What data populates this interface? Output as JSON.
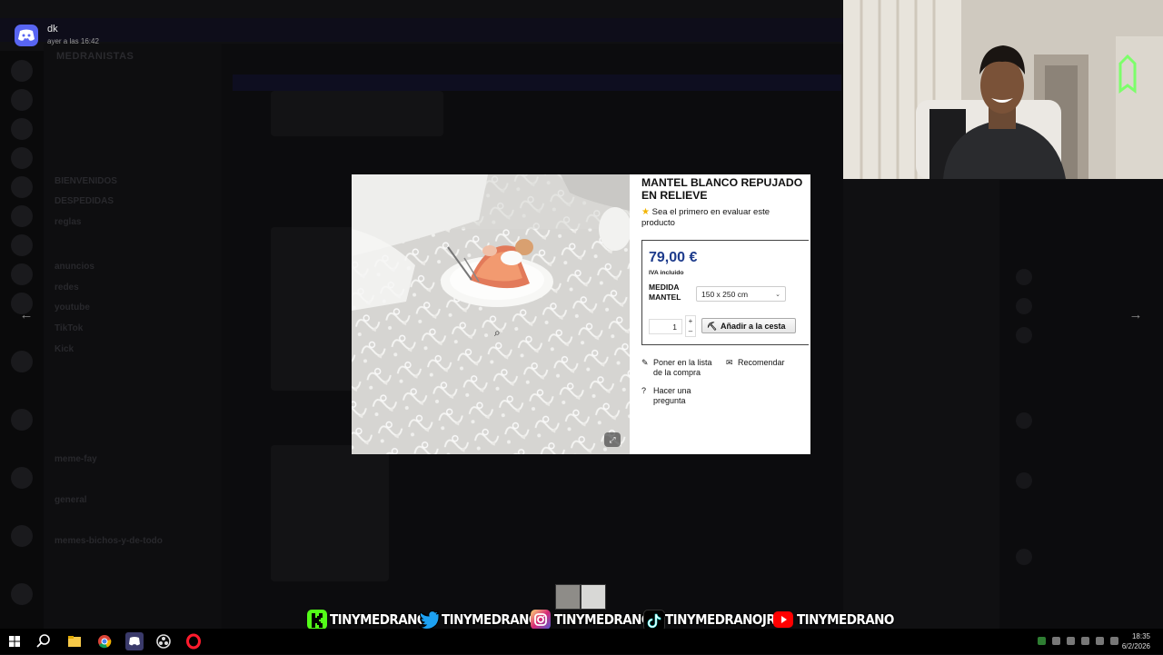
{
  "notification": {
    "sender": "dk",
    "time": "ayer a las 16:42"
  },
  "background_app": {
    "server_name": "MEDRANISTAS",
    "window_title": "MEDRANISTAS",
    "channels": [
      "BIENVENIDOS",
      "DESPEDIDAS",
      "reglas",
      "anuncios",
      "redes",
      "youtube",
      "TikTok",
      "Kick",
      "meme-fay",
      "general",
      "memes-bichos-y-de-todo"
    ]
  },
  "product": {
    "title": "MANTEL BLANCO REPUJADO EN RELIEVE",
    "rating_text": "Sea el primero en evaluar este producto",
    "price": "79,00 €",
    "tax_note": "IVA incluido",
    "measure_label": "MEDIDA MANTEL",
    "measure_value": "150 x 250 cm",
    "quantity": "1",
    "add_to_cart": "Añadir a la cesta",
    "wishlist_link": "Poner en la lista de la compra",
    "recommend_link": "Recomendar",
    "ask_link": "Hacer una pregunta"
  },
  "social_bar": {
    "kick": "TINYMEDRANO",
    "twitter": "TINYMEDRANO",
    "instagram": "TINYMEDRANO",
    "tiktok": "TINYMEDRANOJR",
    "youtube": "TINYMEDRANO",
    "colors": {
      "kick": "#53fc18",
      "twitter": "#1da1f2",
      "instagram": "#d62976",
      "tiktok": "#000000",
      "youtube": "#ff0000"
    }
  },
  "taskbar": {
    "time": "18:35",
    "date": "6/2/2026",
    "apps": [
      "windows-start-icon",
      "search-icon",
      "file-explorer-icon",
      "chrome-icon",
      "discord-icon",
      "obs-icon",
      "opera-icon"
    ]
  },
  "accent_colors": {
    "discord": "#5865f2",
    "price": "#1d3b8c"
  }
}
